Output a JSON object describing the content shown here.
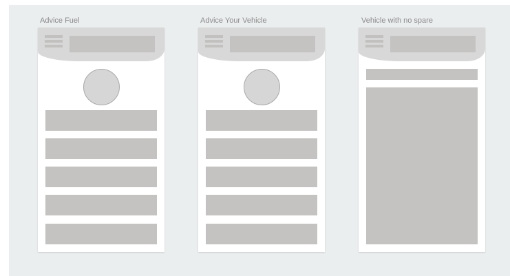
{
  "frames": [
    {
      "label": "Advice Fuel",
      "icons": {
        "menu": "hamburger-menu-icon"
      },
      "list_items": 5
    },
    {
      "label": "Advice Your Vehicle",
      "icons": {
        "menu": "hamburger-menu-icon"
      },
      "list_items": 5
    },
    {
      "label": "Vehicle with no spare",
      "icons": {
        "menu": "hamburger-menu-icon"
      }
    }
  ],
  "colors": {
    "canvas_background": "#ebeeef",
    "placeholder_fill": "#c4c3c1",
    "header_fill": "#d8d8d8",
    "label_text": "#8a8a8a"
  }
}
